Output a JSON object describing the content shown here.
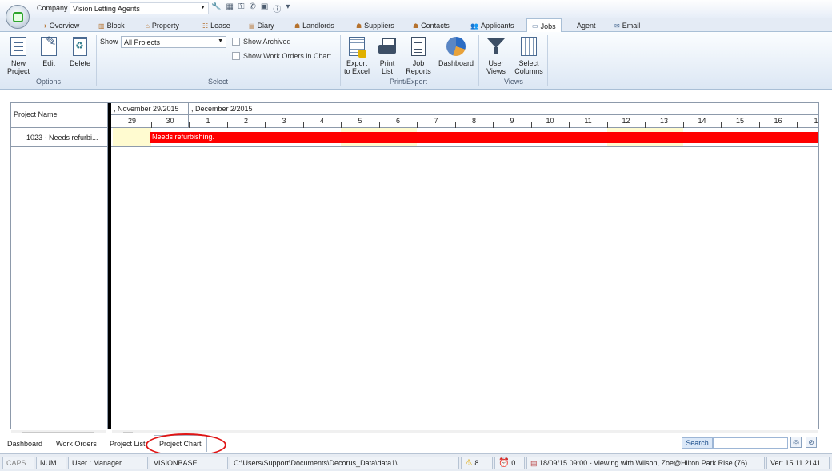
{
  "titlebar": {
    "company_label": "Company",
    "company_value": "Vision Letting Agents"
  },
  "tabs": [
    {
      "label": "Overview",
      "icon": "overview-icon"
    },
    {
      "label": "Block",
      "icon": "block-icon"
    },
    {
      "label": "Property",
      "icon": "property-icon"
    },
    {
      "label": "Lease",
      "icon": "lease-icon"
    },
    {
      "label": "Diary",
      "icon": "diary-icon"
    },
    {
      "label": "Landlords",
      "icon": "landlords-icon"
    },
    {
      "label": "Suppliers",
      "icon": "suppliers-icon"
    },
    {
      "label": "Contacts",
      "icon": "contacts-icon"
    },
    {
      "label": "Applicants",
      "icon": "applicants-icon"
    },
    {
      "label": "Jobs",
      "icon": "jobs-icon"
    },
    {
      "label": "Agent",
      "icon": ""
    },
    {
      "label": "Email",
      "icon": "email-icon"
    }
  ],
  "ribbon": {
    "new_project": [
      "New",
      "Project"
    ],
    "edit": "Edit",
    "delete": "Delete",
    "options_group": "Options",
    "show_label": "Show",
    "show_value": "All Projects",
    "show_archived": "Show Archived",
    "show_work_orders": "Show Work Orders in Chart",
    "select_group": "Select",
    "export": [
      "Export",
      "to Excel"
    ],
    "print": [
      "Print",
      "List"
    ],
    "job_reports": [
      "Job",
      "Reports"
    ],
    "dashboard": "Dashboard",
    "print_group": "Print/Export",
    "user_views": [
      "User",
      "Views"
    ],
    "select_columns": [
      "Select",
      "Columns"
    ],
    "views_group": "Views"
  },
  "chart": {
    "column_header": "Project Name",
    "row_label": "1023 - Needs refurbi...",
    "week1": ", November 29/2015",
    "week2": ", December 2/2015",
    "days": [
      "29",
      "30",
      "1",
      "2",
      "3",
      "4",
      "5",
      "6",
      "7",
      "8",
      "9",
      "10",
      "11",
      "12",
      "13",
      "14",
      "15",
      "16",
      "1"
    ],
    "bar_label": "Needs refurbishing.",
    "bar_color": "#ff0000"
  },
  "bottom_tabs": {
    "dashboard": "Dashboard",
    "work_orders": "Work Orders",
    "project_list": "Project List",
    "project_chart": "Project Chart",
    "search": "Search"
  },
  "status": {
    "caps": "CAPS",
    "num": "NUM",
    "user": "User : Manager",
    "db": "VISIONBASE",
    "path": "C:\\Users\\Support\\Documents\\Decorus_Data\\data1\\",
    "warnings": "8",
    "alarms": "0",
    "info": "18/09/15 09:00 - Viewing with Wilson, Zoe@Hilton Park Rise (76)",
    "version": "Ver: 15.11.2141"
  }
}
